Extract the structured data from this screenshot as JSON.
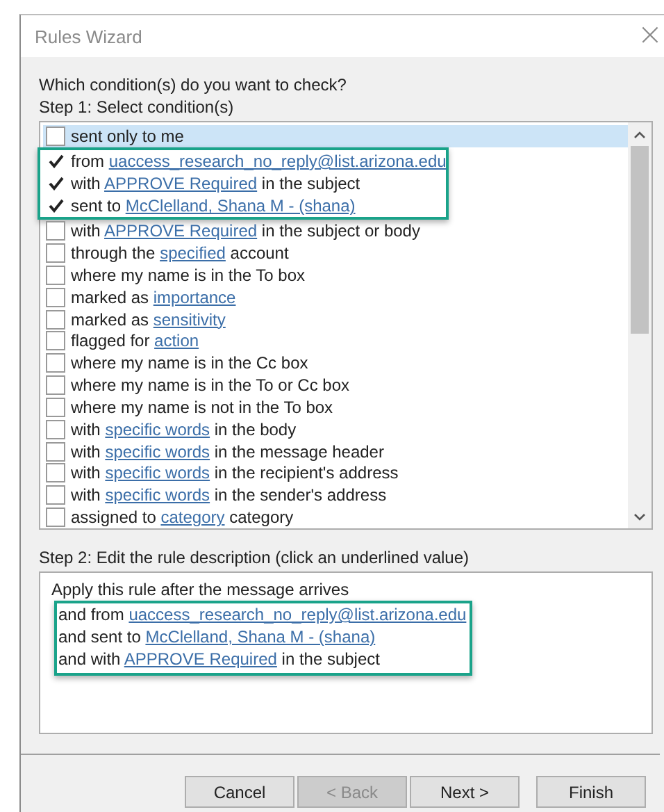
{
  "window": {
    "title": "Rules Wizard",
    "close": "×"
  },
  "prompt": "Which condition(s) do you want to check?",
  "step1": {
    "label": "Step 1: Select condition(s)",
    "conditions": [
      {
        "checked": false,
        "selected": true,
        "highlighted": false,
        "parts": [
          {
            "text": "sent only to me",
            "link": false
          }
        ]
      },
      {
        "checked": true,
        "selected": false,
        "highlighted": true,
        "parts": [
          {
            "text": "from ",
            "link": false
          },
          {
            "text": "uaccess_research_no_reply@list.arizona.edu",
            "link": true
          }
        ]
      },
      {
        "checked": true,
        "selected": false,
        "highlighted": true,
        "parts": [
          {
            "text": "with ",
            "link": false
          },
          {
            "text": "APPROVE Required",
            "link": true
          },
          {
            "text": " in the subject",
            "link": false
          }
        ]
      },
      {
        "checked": true,
        "selected": false,
        "highlighted": true,
        "parts": [
          {
            "text": "sent to ",
            "link": false
          },
          {
            "text": "McClelland, Shana M - (shana)",
            "link": true
          }
        ]
      },
      {
        "checked": false,
        "selected": false,
        "highlighted": false,
        "parts": [
          {
            "text": "with ",
            "link": false
          },
          {
            "text": "APPROVE Required",
            "link": true
          },
          {
            "text": " in the subject or body",
            "link": false
          }
        ]
      },
      {
        "checked": false,
        "selected": false,
        "highlighted": false,
        "parts": [
          {
            "text": "through the ",
            "link": false
          },
          {
            "text": "specified",
            "link": true
          },
          {
            "text": " account",
            "link": false
          }
        ]
      },
      {
        "checked": false,
        "selected": false,
        "highlighted": false,
        "parts": [
          {
            "text": "where my name is in the To box",
            "link": false
          }
        ]
      },
      {
        "checked": false,
        "selected": false,
        "highlighted": false,
        "parts": [
          {
            "text": "marked as ",
            "link": false
          },
          {
            "text": "importance",
            "link": true
          }
        ]
      },
      {
        "checked": false,
        "selected": false,
        "highlighted": false,
        "parts": [
          {
            "text": "marked as ",
            "link": false
          },
          {
            "text": "sensitivity",
            "link": true
          }
        ]
      },
      {
        "checked": false,
        "selected": false,
        "highlighted": false,
        "parts": [
          {
            "text": "flagged for ",
            "link": false
          },
          {
            "text": "action",
            "link": true
          }
        ]
      },
      {
        "checked": false,
        "selected": false,
        "highlighted": false,
        "parts": [
          {
            "text": "where my name is in the Cc box",
            "link": false
          }
        ]
      },
      {
        "checked": false,
        "selected": false,
        "highlighted": false,
        "parts": [
          {
            "text": "where my name is in the To or Cc box",
            "link": false
          }
        ]
      },
      {
        "checked": false,
        "selected": false,
        "highlighted": false,
        "parts": [
          {
            "text": "where my name is not in the To box",
            "link": false
          }
        ]
      },
      {
        "checked": false,
        "selected": false,
        "highlighted": false,
        "parts": [
          {
            "text": "with ",
            "link": false
          },
          {
            "text": "specific words",
            "link": true
          },
          {
            "text": " in the body",
            "link": false
          }
        ]
      },
      {
        "checked": false,
        "selected": false,
        "highlighted": false,
        "parts": [
          {
            "text": "with ",
            "link": false
          },
          {
            "text": "specific words",
            "link": true
          },
          {
            "text": " in the message header",
            "link": false
          }
        ]
      },
      {
        "checked": false,
        "selected": false,
        "highlighted": false,
        "parts": [
          {
            "text": "with ",
            "link": false
          },
          {
            "text": "specific words",
            "link": true
          },
          {
            "text": " in the recipient's address",
            "link": false
          }
        ]
      },
      {
        "checked": false,
        "selected": false,
        "highlighted": false,
        "parts": [
          {
            "text": "with ",
            "link": false
          },
          {
            "text": "specific words",
            "link": true
          },
          {
            "text": " in the sender's address",
            "link": false
          }
        ]
      },
      {
        "checked": false,
        "selected": false,
        "highlighted": false,
        "parts": [
          {
            "text": "assigned to ",
            "link": false
          },
          {
            "text": "category",
            "link": true
          },
          {
            "text": " category",
            "link": false
          }
        ]
      }
    ]
  },
  "step2": {
    "label": "Step 2: Edit the rule description (click an underlined value)",
    "lines": [
      {
        "highlighted": false,
        "parts": [
          {
            "text": "Apply this rule after the message arrives",
            "link": false
          }
        ]
      },
      {
        "highlighted": true,
        "parts": [
          {
            "text": "and from ",
            "link": false
          },
          {
            "text": "uaccess_research_no_reply@list.arizona.edu",
            "link": true
          }
        ]
      },
      {
        "highlighted": true,
        "parts": [
          {
            "text": "and sent to ",
            "link": false
          },
          {
            "text": "McClelland, Shana M - (shana)",
            "link": true
          }
        ]
      },
      {
        "highlighted": true,
        "parts": [
          {
            "text": "and with ",
            "link": false
          },
          {
            "text": "APPROVE Required",
            "link": true
          },
          {
            "text": " in the subject",
            "link": false
          }
        ]
      }
    ]
  },
  "buttons": [
    {
      "label": "Cancel",
      "disabled": false
    },
    {
      "label": "< Back",
      "disabled": true
    },
    {
      "label": "Next >",
      "disabled": false
    },
    {
      "label": "Finish",
      "disabled": false
    }
  ]
}
